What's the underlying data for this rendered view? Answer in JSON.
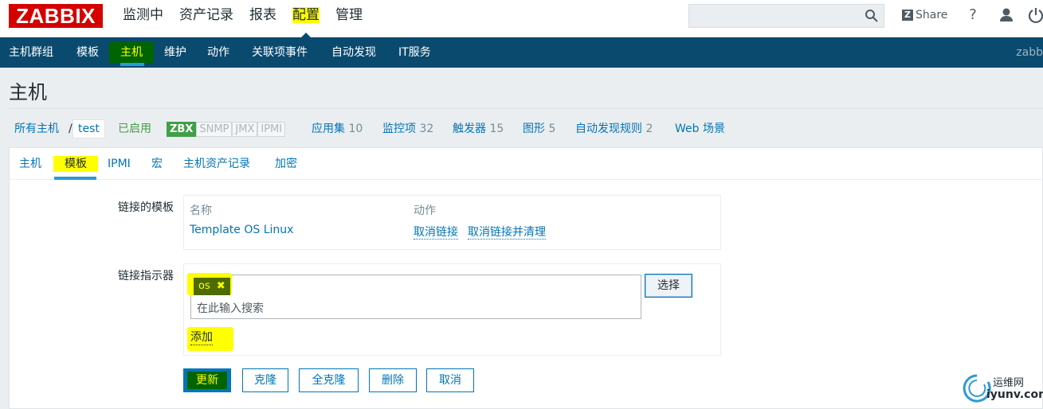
{
  "header": {
    "logo": "ZABBIX",
    "nav": [
      "监测中",
      "资产记录",
      "报表",
      "配置",
      "管理"
    ],
    "share": "Share",
    "help": "?",
    "search_placeholder": ""
  },
  "subnav": {
    "items": [
      "主机群组",
      "模板",
      "主机",
      "维护",
      "动作",
      "关联项事件",
      "自动发现",
      "IT服务"
    ],
    "right": "zabb"
  },
  "page": {
    "title": "主机"
  },
  "hostbar": {
    "all_hosts": "所有主机",
    "sep": "/",
    "host": "test",
    "status": "已启用",
    "protocols": [
      "ZBX",
      "SNMP",
      "JMX",
      "IPMI"
    ],
    "links": [
      {
        "label": "应用集",
        "count": "10"
      },
      {
        "label": "监控项",
        "count": "32"
      },
      {
        "label": "触发器",
        "count": "15"
      },
      {
        "label": "图形",
        "count": "5"
      },
      {
        "label": "自动发现规则",
        "count": "2"
      },
      {
        "label": "Web 场景",
        "count": ""
      }
    ]
  },
  "tabs": [
    "主机",
    "模板",
    "IPMI",
    "宏",
    "主机资产记录",
    "加密"
  ],
  "form": {
    "linked_label": "链接的模板",
    "col_name": "名称",
    "col_action": "动作",
    "template": "Template OS Linux",
    "unlink": "取消链接",
    "unlink_clear": "取消链接并清理",
    "link_label": "链接指示器",
    "chip": "os",
    "chip_x": "✖",
    "placeholder": "在此输入搜索",
    "select": "选择",
    "add": "添加"
  },
  "buttons": [
    "更新",
    "克隆",
    "全克隆",
    "删除",
    "取消"
  ],
  "watermark": {
    "line1": "运维网",
    "line2": "iyunv.com"
  }
}
